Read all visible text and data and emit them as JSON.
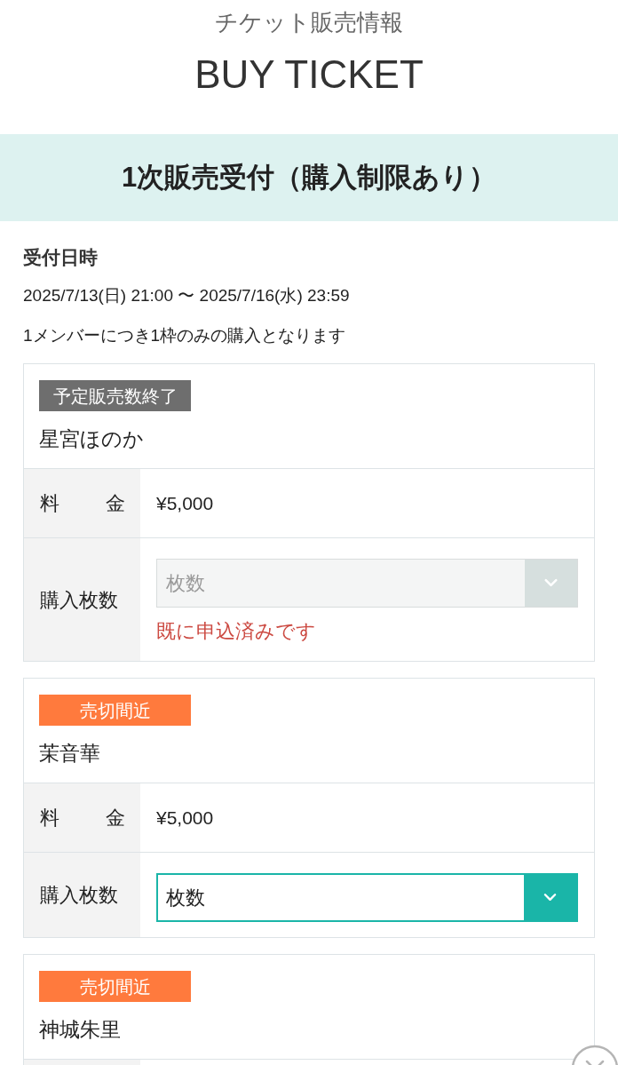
{
  "header": {
    "subtitle": "チケット販売情報",
    "title": "BUY TICKET"
  },
  "banner": {
    "title": "1次販売受付（購入制限あり）"
  },
  "period": {
    "heading": "受付日時",
    "dates": "2025/7/13(日) 21:00 〜 2025/7/16(水) 23:59",
    "note": "1メンバーにつき1枠のみの購入となります"
  },
  "cards": [
    {
      "badge": {
        "text": "予定販売数終了",
        "color": "#6e6e6e"
      },
      "name": "星宮ほのか",
      "rows": [
        {
          "kind": "price",
          "label": "料 金",
          "value": "¥5,000"
        },
        {
          "kind": "quantity",
          "label": "購入枚数",
          "select": {
            "value": "枚数",
            "disabled": true
          },
          "error": "既に申込済みです"
        }
      ]
    },
    {
      "badge": {
        "text": "売切間近",
        "color": "#ff7a3d"
      },
      "name": "茉音華",
      "rows": [
        {
          "kind": "price",
          "label": "料 金",
          "value": "¥5,000"
        },
        {
          "kind": "quantity",
          "label": "購入枚数",
          "select": {
            "value": "枚数",
            "disabled": false
          }
        }
      ]
    },
    {
      "badge": {
        "text": "売切間近",
        "color": "#ff7a3d"
      },
      "name": "神城朱里",
      "rows": [
        {
          "kind": "partial"
        }
      ]
    }
  ]
}
